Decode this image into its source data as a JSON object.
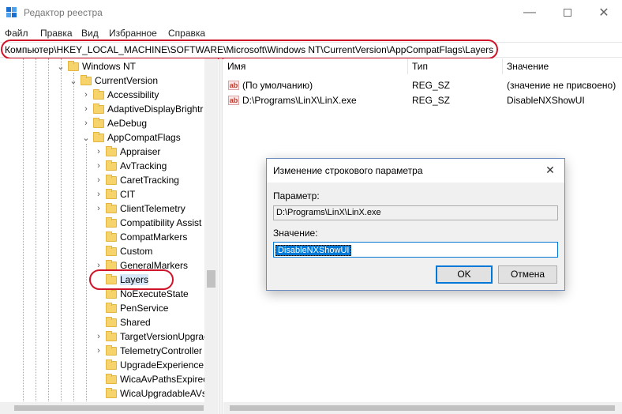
{
  "window": {
    "title": "Редактор реестра",
    "minimize_glyph": "—",
    "close_glyph": "✕"
  },
  "menu": [
    "Файл",
    "Правка",
    "Вид",
    "Избранное",
    "Справка"
  ],
  "address": "Компьютер\\HKEY_LOCAL_MACHINE\\SOFTWARE\\Microsoft\\Windows NT\\CurrentVersion\\AppCompatFlags\\Layers",
  "tree": {
    "items": [
      {
        "label": "Windows NT",
        "chevron": "⌄"
      },
      {
        "label": "CurrentVersion",
        "chevron": "⌄"
      },
      {
        "label": "Accessibility",
        "chevron": "›"
      },
      {
        "label": "AdaptiveDisplayBrightr",
        "chevron": "›"
      },
      {
        "label": "AeDebug",
        "chevron": "›"
      },
      {
        "label": "AppCompatFlags",
        "chevron": "⌄"
      },
      {
        "label": "Appraiser",
        "chevron": "›"
      },
      {
        "label": "AvTracking",
        "chevron": "›"
      },
      {
        "label": "CaretTracking",
        "chevron": "›"
      },
      {
        "label": "CIT",
        "chevron": "›"
      },
      {
        "label": "ClientTelemetry",
        "chevron": "›"
      },
      {
        "label": "Compatibility Assist",
        "chevron": ""
      },
      {
        "label": "CompatMarkers",
        "chevron": ""
      },
      {
        "label": "Custom",
        "chevron": ""
      },
      {
        "label": "GeneralMarkers",
        "chevron": "›"
      },
      {
        "label": "Layers",
        "chevron": ""
      },
      {
        "label": "NoExecuteState",
        "chevron": ""
      },
      {
        "label": "PenService",
        "chevron": ""
      },
      {
        "label": "Shared",
        "chevron": ""
      },
      {
        "label": "TargetVersionUpgrac",
        "chevron": "›"
      },
      {
        "label": "TelemetryController",
        "chevron": "›"
      },
      {
        "label": "UpgradeExperienceI",
        "chevron": ""
      },
      {
        "label": "WicaAvPathsExpirec",
        "chevron": ""
      },
      {
        "label": "WicaUpgradableAVs",
        "chevron": ""
      }
    ]
  },
  "values_pane": {
    "columns": [
      "Имя",
      "Тип",
      "Значение"
    ],
    "rows": [
      {
        "icon": "ab",
        "name": "(По умолчанию)",
        "type": "REG_SZ",
        "data": "(значение не присвоено)"
      },
      {
        "icon": "ab",
        "name": "D:\\Programs\\LinX\\LinX.exe",
        "type": "REG_SZ",
        "data": "DisableNXShowUI"
      }
    ]
  },
  "dialog": {
    "title": "Изменение строкового параметра",
    "close_glyph": "✕",
    "param_label": "Параметр:",
    "param_value": "D:\\Programs\\LinX\\LinX.exe",
    "value_label": "Значение:",
    "value_value": "DisableNXShowUI",
    "ok": "OK",
    "cancel": "Отмена"
  },
  "colors": {
    "highlight_oval": "#d0142a",
    "selection": "#0078d7",
    "folder": "#f6d36b"
  }
}
